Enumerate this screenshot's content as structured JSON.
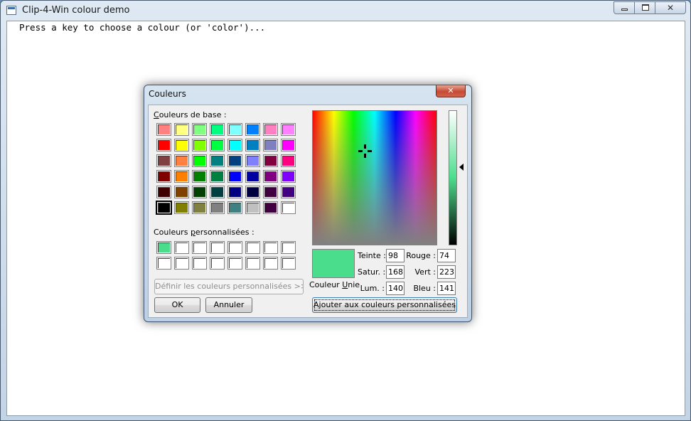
{
  "window": {
    "title": "Clip-4-Win colour demo",
    "close_glyph": "✕"
  },
  "console": {
    "prompt": "Press a key to choose a colour (or 'color')..."
  },
  "dialog": {
    "title": "Couleurs",
    "close_glyph": "✕",
    "basic_label_ul": "C",
    "basic_label_rest": "ouleurs de base :",
    "custom_label_pre": "Couleurs ",
    "custom_label_ul": "p",
    "custom_label_rest": "ersonnalisées :",
    "define_button": "Définir les couleurs personnalisées >>",
    "ok_button": "OK",
    "cancel_button": "Annuler",
    "add_button": "Ajouter aux couleurs personnalisées",
    "preview_label_pre": "Couleur",
    "preview_label_ul": "U",
    "preview_label_rest": "nie",
    "preview_color": "#4ade8c",
    "fields": {
      "hue_label": "Teinte :",
      "hue_value": "98",
      "sat_label": "Satur. :",
      "sat_value": "168",
      "lum_label": "Lum. :",
      "lum_value": "140",
      "red_label": "Rouge :",
      "red_value": "74",
      "green_label": "Vert :",
      "green_value": "223",
      "blue_label": "Bleu :",
      "blue_value": "141"
    },
    "basic_colors": [
      "#ff8080",
      "#ffff80",
      "#80ff80",
      "#00ff80",
      "#80ffff",
      "#0080ff",
      "#ff80c0",
      "#ff80ff",
      "#ff0000",
      "#ffff00",
      "#80ff00",
      "#00ff40",
      "#00ffff",
      "#0080c0",
      "#8080c0",
      "#ff00ff",
      "#804040",
      "#ff8040",
      "#00ff00",
      "#008080",
      "#004080",
      "#8080ff",
      "#800040",
      "#ff0080",
      "#800000",
      "#ff8000",
      "#008000",
      "#008040",
      "#0000ff",
      "#0000a0",
      "#800080",
      "#8000ff",
      "#400000",
      "#804000",
      "#004000",
      "#004040",
      "#000080",
      "#000040",
      "#400040",
      "#400080",
      "#000000",
      "#808000",
      "#808040",
      "#808080",
      "#408080",
      "#c0c0c0",
      "#400040",
      "#ffffff"
    ],
    "selected_basic_index": 40,
    "custom_colors": [
      "#4ade8c",
      "#ffffff",
      "#ffffff",
      "#ffffff",
      "#ffffff",
      "#ffffff",
      "#ffffff",
      "#ffffff",
      "#ffffff",
      "#ffffff",
      "#ffffff",
      "#ffffff",
      "#ffffff",
      "#ffffff",
      "#ffffff",
      "#ffffff"
    ]
  }
}
